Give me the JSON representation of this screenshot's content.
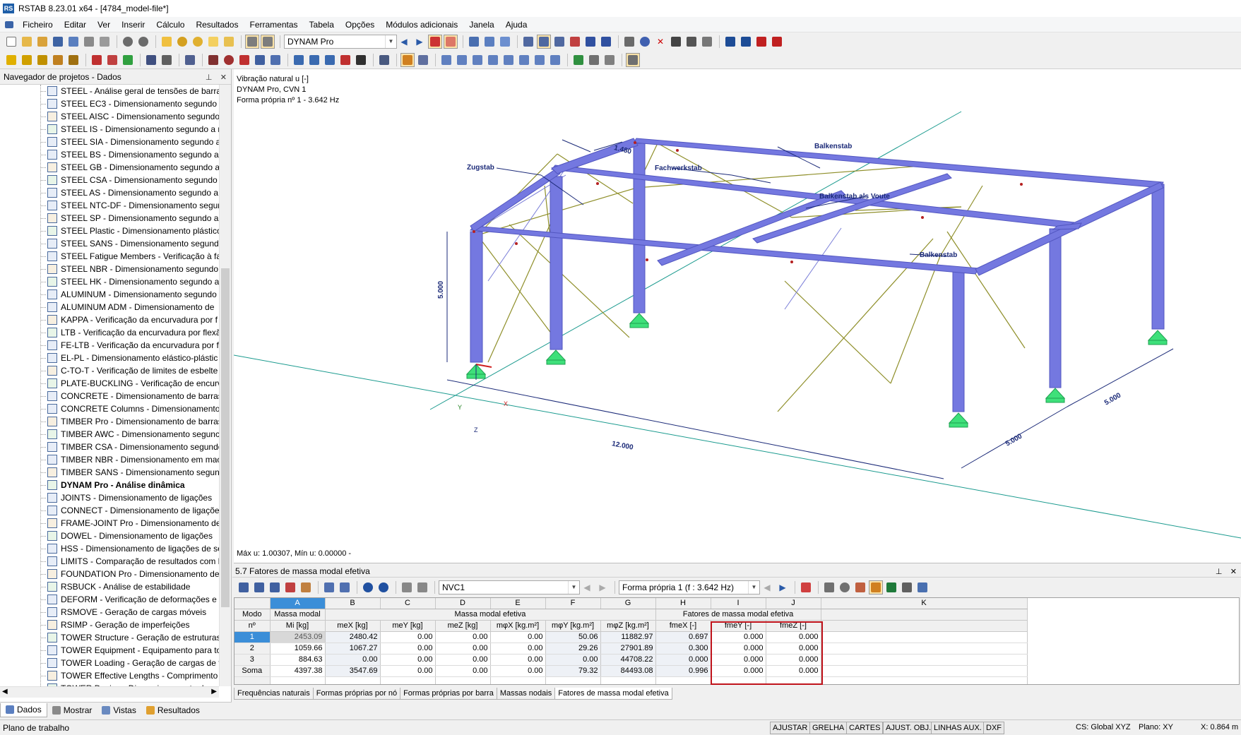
{
  "window": {
    "title": "RSTAB 8.23.01 x64 - [4784_model-file*]",
    "app_icon": "RS"
  },
  "menu": [
    "Ficheiro",
    "Editar",
    "Ver",
    "Inserir",
    "Cálculo",
    "Resultados",
    "Ferramentas",
    "Tabela",
    "Opções",
    "Módulos adicionais",
    "Janela",
    "Ajuda"
  ],
  "toolbar": {
    "module_select": "DYNAM Pro"
  },
  "navigator": {
    "title": "Navegador de projetos - Dados",
    "items": [
      "STEEL - Análise geral de tensões de barras",
      "STEEL EC3 - Dimensionamento segundo c",
      "STEEL AISC - Dimensionamento segundo",
      "STEEL IS - Dimensionamento segundo a n",
      "STEEL SIA - Dimensionamento segundo a",
      "STEEL BS - Dimensionamento segundo a i",
      "STEEL GB - Dimensionamento segundo a",
      "STEEL CSA - Dimensionamento segundo a",
      "STEEL AS - Dimensionamento segundo a i",
      "STEEL NTC-DF - Dimensionamento segund",
      "STEEL SP - Dimensionamento segundo a r",
      "STEEL Plastic - Dimensionamento plástico",
      "STEEL SANS - Dimensionamento segundo",
      "STEEL Fatigue Members - Verificação à fad",
      "STEEL NBR - Dimensionamento segundo a",
      "STEEL HK - Dimensionamento segundo a",
      "ALUMINUM - Dimensionamento segundo",
      "ALUMINUM ADM - Dimensionamento de",
      "KAPPA - Verificação da encurvadura por f",
      "LTB - Verificação da encurvadura por flexã",
      "FE-LTB - Verificação da encurvadura por f",
      "EL-PL - Dimensionamento elástico-plástic",
      "C-TO-T - Verificação de limites de esbelte",
      "PLATE-BUCKLING - Verificação de encurv",
      "CONCRETE - Dimensionamento de barras",
      "CONCRETE Columns - Dimensionamento",
      "TIMBER Pro - Dimensionamento de barras",
      "TIMBER AWC - Dimensionamento segunc",
      "TIMBER CSA - Dimensionamento segundo",
      "TIMBER NBR - Dimensionamento em mac",
      "TIMBER SANS - Dimensionamento segunc",
      "DYNAM Pro - Análise dinâmica",
      "JOINTS - Dimensionamento de ligações",
      "CONNECT - Dimensionamento de ligaçõe",
      "FRAME-JOINT Pro - Dimensionamento de",
      "DOWEL - Dimensionamento de ligações",
      "HSS - Dimensionamento de ligações de se",
      "LIMITS - Comparação de resultados com l",
      "FOUNDATION Pro - Dimensionamento de",
      "RSBUCK - Análise de estabilidade",
      "DEFORM - Verificação de deformações e f",
      "RSMOVE - Geração de cargas móveis",
      "RSIMP - Geração de imperfeições",
      "TOWER Structure - Geração de estruturas",
      "TOWER Equipment - Equipamento para to",
      "TOWER Loading - Geração de cargas de to",
      "TOWER Effective Lengths - Comprimento",
      "TOWER Design - Dimensionamento de"
    ],
    "bold_index": 31,
    "tabs": [
      "Dados",
      "Mostrar",
      "Vistas",
      "Resultados"
    ]
  },
  "viewport": {
    "info": [
      "Vibração natural u [-]",
      "DYNAM Pro, CVN 1",
      "Forma própria nº 1 - 3.642 Hz"
    ],
    "minmax": "Máx u: 1.00307, Mín u: 0.00000 -",
    "labels": {
      "zugstab": "Zugstab",
      "fachwerkstab": "Fachwerkstab",
      "balkenstab_top": "Balkenstab",
      "balkenstab_voute": "Balkenstab als Voute",
      "balkenstab_right": "Balkenstab",
      "dim_1480": "1.480",
      "dim_5000_v": "5.000",
      "dim_12000": "12.000",
      "dim_5000_a": "5.000",
      "dim_5000_b": "5.000",
      "axis_x": "X",
      "axis_y": "Y",
      "axis_z": "Z"
    },
    "colors": {
      "member": "#7478e0",
      "diagonal": "#8f8f2a",
      "support": "#3ee07a",
      "axis_line": "#1a9a8e"
    }
  },
  "results": {
    "title": "5.7 Fatores de massa modal efetiva",
    "combo_case": "NVC1",
    "combo_mode": "Forma própria 1 (f : 3.642 Hz)",
    "col_letters": [
      "A",
      "B",
      "C",
      "D",
      "E",
      "F",
      "G",
      "H",
      "I",
      "J",
      "K"
    ],
    "header_row1": {
      "mode": "Modo",
      "modal_mass": "Massa modal",
      "eff_mass": "Massa modal efetiva",
      "factors": "Fatores de massa modal efetiva"
    },
    "header_row2": {
      "mode_no": "nº",
      "mi": "Mi [kg]",
      "mex": "meX [kg]",
      "mey": "meY [kg]",
      "mez": "meZ [kg]",
      "mphix": "mφX [kg.m²]",
      "mphiy": "mφY [kg.m²]",
      "mphiz": "mφZ [kg.m²]",
      "fmex": "fmeX [-]",
      "fmey": "fmeY [-]",
      "fmez": "fmeZ [-]"
    },
    "rows": [
      {
        "mode": "1",
        "mi": "2453.09",
        "mex": "2480.42",
        "mey": "0.00",
        "mez": "0.00",
        "mphix": "0.00",
        "mphiy": "50.06",
        "mphiz": "11882.97",
        "fmex": "0.697",
        "fmey": "0.000",
        "fmez": "0.000"
      },
      {
        "mode": "2",
        "mi": "1059.66",
        "mex": "1067.27",
        "mey": "0.00",
        "mez": "0.00",
        "mphix": "0.00",
        "mphiy": "29.26",
        "mphiz": "27901.89",
        "fmex": "0.300",
        "fmey": "0.000",
        "fmez": "0.000"
      },
      {
        "mode": "3",
        "mi": "884.63",
        "mex": "0.00",
        "mey": "0.00",
        "mez": "0.00",
        "mphix": "0.00",
        "mphiy": "0.00",
        "mphiz": "44708.22",
        "fmex": "0.000",
        "fmey": "0.000",
        "fmez": "0.000"
      },
      {
        "mode": "Soma",
        "mi": "4397.38",
        "mex": "3547.69",
        "mey": "0.00",
        "mez": "0.00",
        "mphix": "0.00",
        "mphiy": "79.32",
        "mphiz": "84493.08",
        "fmex": "0.996",
        "fmey": "0.000",
        "fmez": "0.000"
      }
    ],
    "tabs": [
      "Frequências naturais",
      "Formas próprias por nó",
      "Formas próprias por barra",
      "Massas nodais",
      "Fatores de massa modal efetiva"
    ]
  },
  "statusbar": {
    "text": "Plano de trabalho",
    "buttons": [
      "AJUSTAR",
      "GRELHA",
      "CARTES",
      "AJUST. OBJ.",
      "LINHAS AUX.",
      "DXF"
    ],
    "cs": "CS: Global XYZ",
    "plane": "Plano: XY",
    "coord": "X:   0.864 m"
  }
}
